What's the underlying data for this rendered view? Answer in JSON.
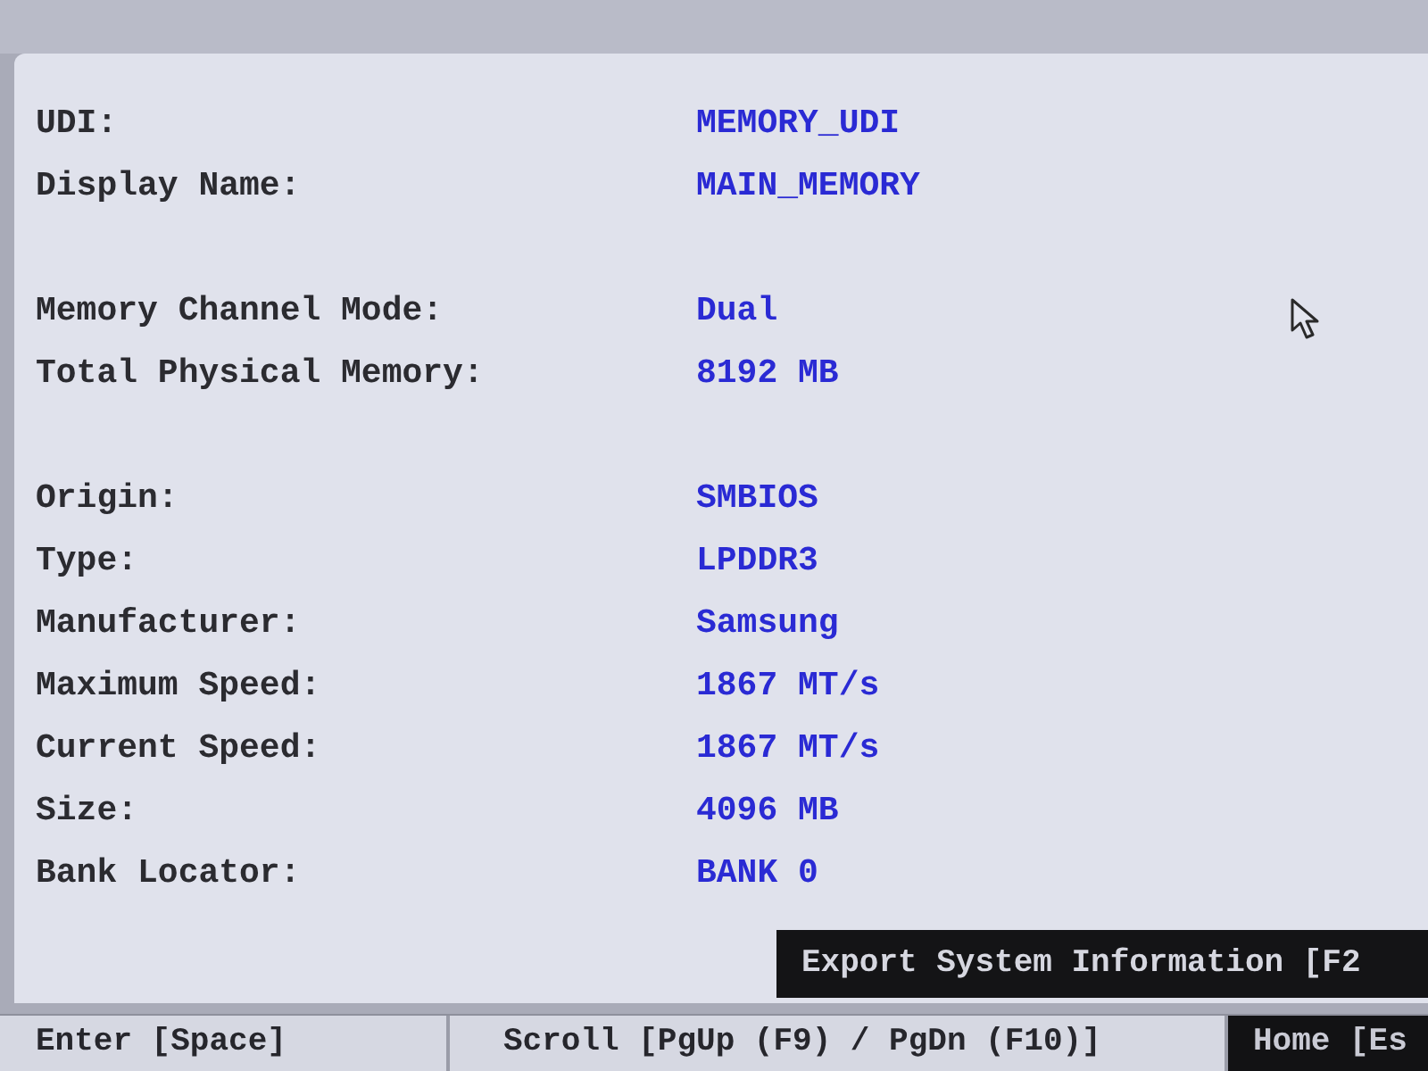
{
  "sections": [
    {
      "fields": [
        {
          "label": "UDI:",
          "value": "MEMORY_UDI"
        },
        {
          "label": "Display Name:",
          "value": "MAIN_MEMORY"
        }
      ]
    },
    {
      "fields": [
        {
          "label": "Memory Channel Mode:",
          "value": "Dual"
        },
        {
          "label": "Total Physical Memory:",
          "value": "8192 MB"
        }
      ]
    },
    {
      "fields": [
        {
          "label": "Origin:",
          "value": "SMBIOS"
        },
        {
          "label": "Type:",
          "value": "LPDDR3"
        },
        {
          "label": "Manufacturer:",
          "value": "Samsung"
        },
        {
          "label": "Maximum Speed:",
          "value": "1867 MT/s"
        },
        {
          "label": "Current Speed:",
          "value": "1867 MT/s"
        },
        {
          "label": "Size:",
          "value": "4096 MB"
        },
        {
          "label": "Bank Locator:",
          "value": "BANK 0"
        }
      ]
    }
  ],
  "export_button": {
    "label": "Export System Information [F2"
  },
  "footer": {
    "keys": [
      {
        "label": "Enter [Space]",
        "kind": "plain"
      },
      {
        "label": "Scroll [PgUp (F9) / PgDn (F10)]",
        "kind": "plain"
      },
      {
        "label": "Home [Es",
        "kind": "dark"
      }
    ]
  }
}
